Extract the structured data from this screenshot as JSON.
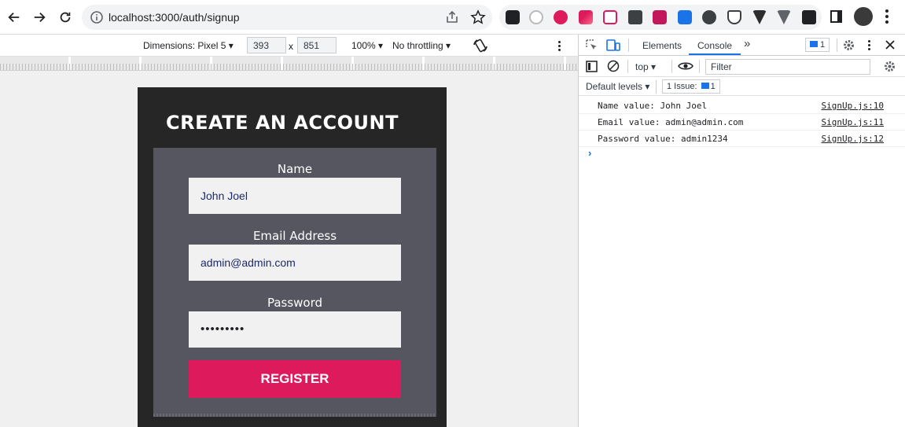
{
  "browser": {
    "url": "localhost:3000/auth/signup"
  },
  "device_toolbar": {
    "dimensions_label": "Dimensions: Pixel 5",
    "width": "393",
    "times": "x",
    "height": "851",
    "zoom": "100%",
    "throttling": "No throttling"
  },
  "page": {
    "title": "CREATE AN ACCOUNT",
    "name_label": "Name",
    "name_value": "John Joel",
    "email_label": "Email Address",
    "email_value": "admin@admin.com",
    "password_label": "Password",
    "password_value": "•••••••••",
    "register_label": "REGISTER"
  },
  "devtools": {
    "tabs": [
      "Elements",
      "Console"
    ],
    "more_tabs": "»",
    "issues_count": "1",
    "context": "top",
    "filter_placeholder": "Filter",
    "levels": "Default levels",
    "issue_badge": "1 Issue:",
    "issue_badge_count": "1",
    "logs": [
      {
        "message": "Name value: John Joel",
        "source": "SignUp.js:10"
      },
      {
        "message": "Email value: admin@admin.com",
        "source": "SignUp.js:11"
      },
      {
        "message": "Password value: admin1234",
        "source": "SignUp.js:12"
      }
    ],
    "prompt": "›"
  },
  "colors": {
    "accent": "#dc1a5c",
    "form_bg": "#55565f",
    "device_bg": "#262626",
    "devtools_blue": "#1a73e8"
  }
}
